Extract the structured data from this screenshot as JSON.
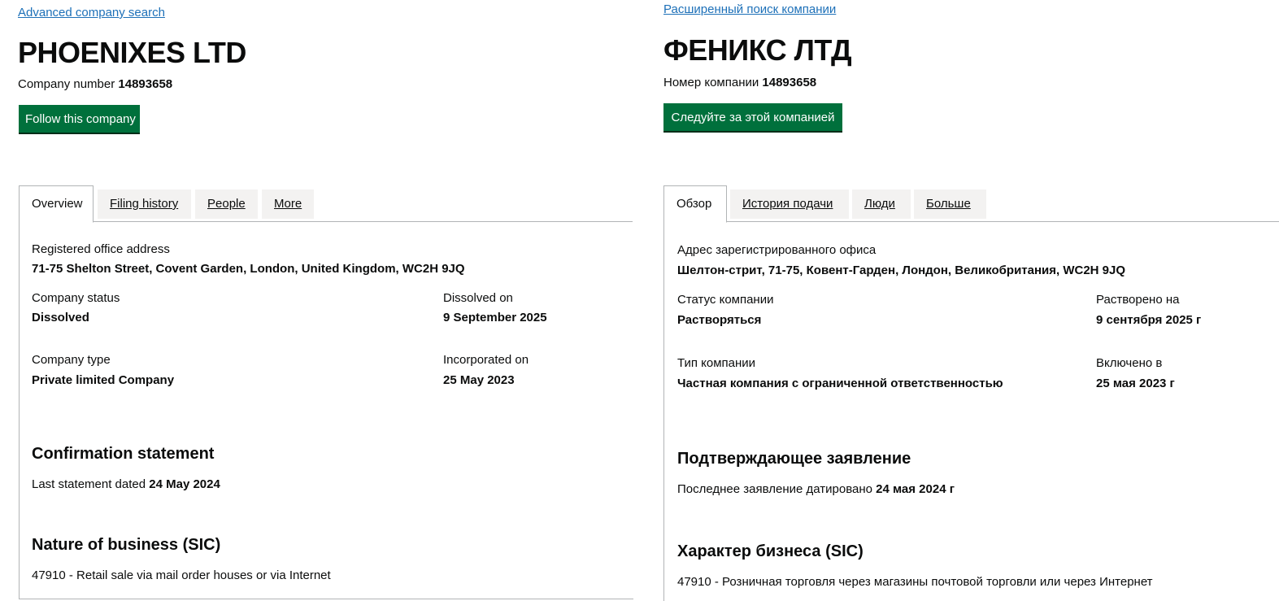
{
  "en": {
    "advanced_search_link": "Advanced company search",
    "company_name": "PHOENIXES LTD",
    "company_number_label": "Company number",
    "company_number": "14893658",
    "follow_button": "Follow this company",
    "tabs": [
      {
        "label": "Overview",
        "active": true
      },
      {
        "label": "Filing history",
        "active": false
      },
      {
        "label": "People",
        "active": false
      },
      {
        "label": "More",
        "active": false
      }
    ],
    "registered_office_label": "Registered office address",
    "registered_office_value": "71-75 Shelton Street, Covent Garden, London, United Kingdom, WC2H 9JQ",
    "company_status_label": "Company status",
    "company_status_value": "Dissolved",
    "dissolved_on_label": "Dissolved on",
    "dissolved_on_value": "9 September 2025",
    "company_type_label": "Company type",
    "company_type_value": "Private limited Company",
    "incorporated_on_label": "Incorporated on",
    "incorporated_on_value": "25 May 2023",
    "confirmation_heading": "Confirmation statement",
    "last_statement_label": "Last statement dated",
    "last_statement_value": "24 May 2024",
    "nature_heading": "Nature of business (SIC)",
    "sic_text": "47910 - Retail sale via mail order houses or via Internet"
  },
  "ru": {
    "advanced_search_link": "Расширенный поиск компании",
    "company_name": "ФЕНИКС ЛТД",
    "company_number_label": "Номер компании",
    "company_number": "14893658",
    "follow_button": "Следуйте за этой компанией",
    "tabs": [
      {
        "label": "Обзор",
        "active": true
      },
      {
        "label": "История подачи",
        "active": false
      },
      {
        "label": "Люди",
        "active": false
      },
      {
        "label": "Больше",
        "active": false
      }
    ],
    "registered_office_label": "Адрес зарегистрированного офиса",
    "registered_office_value": "Шелтон-стрит, 71-75, Ковент-Гарден, Лондон, Великобритания, WC2H 9JQ",
    "company_status_label": "Статус компании",
    "company_status_value": "Растворяться",
    "dissolved_on_label": "Растворено на",
    "dissolved_on_value": "9 сентября 2025 г",
    "company_type_label": "Тип компании",
    "company_type_value": "Частная компания с ограниченной ответственностью",
    "incorporated_on_label": "Включено в",
    "incorporated_on_value": "25 мая 2023 г",
    "confirmation_heading": "Подтверждающее заявление",
    "last_statement_label": "Последнее заявление датировано",
    "last_statement_value": "24 мая 2024 г",
    "nature_heading": "Характер бизнеса (SIC)",
    "sic_text": "47910 - Розничная торговля через магазины почтовой торговли или через Интернет"
  },
  "colors": {
    "link": "#1d70b8",
    "button_green": "#00703c",
    "text": "#0b0c0c",
    "tab_inactive_bg": "#f3f2f1",
    "border": "#b1b4b6"
  }
}
